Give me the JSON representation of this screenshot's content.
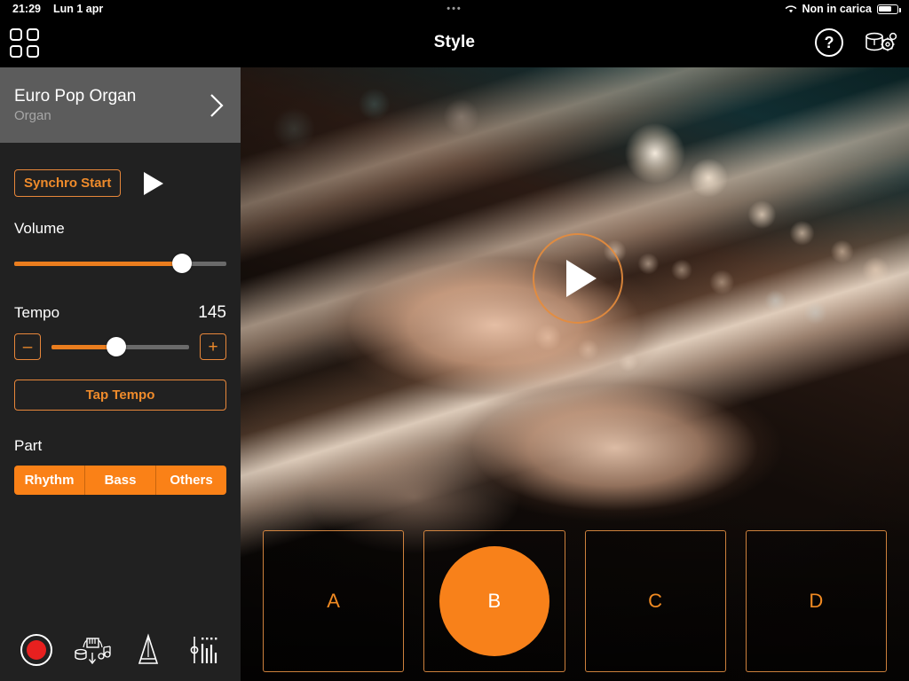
{
  "statusbar": {
    "time": "21:29",
    "date": "Lun 1 apr",
    "dots": "•••",
    "battery_text": "Non in carica",
    "wifi_icon": "wifi-icon",
    "battery_icon": "battery-icon"
  },
  "header": {
    "title": "Style",
    "grid_icon": "grid-icon",
    "help_icon": "help-icon",
    "help_label": "?",
    "database_icon": "database-settings-icon"
  },
  "sidebar": {
    "style_card": {
      "name": "Euro Pop Organ",
      "category": "Organ",
      "chevron_icon": "chevron-right-icon"
    },
    "synchro_start_label": "Synchro Start",
    "play_icon": "play-icon",
    "volume": {
      "label": "Volume",
      "value_pct": 79
    },
    "tempo": {
      "label": "Tempo",
      "value": "145",
      "value_pct": 47,
      "minus_label": "–",
      "plus_label": "+",
      "tap_tempo_label": "Tap Tempo"
    },
    "part": {
      "label": "Part",
      "segments": [
        {
          "label": "Rhythm"
        },
        {
          "label": "Bass"
        },
        {
          "label": "Others"
        }
      ]
    }
  },
  "toolbar": {
    "items": [
      {
        "icon": "record-icon"
      },
      {
        "icon": "drum-keyboard-notes-icon"
      },
      {
        "icon": "metronome-icon"
      },
      {
        "icon": "mixer-fader-icon"
      }
    ]
  },
  "stage": {
    "play_button_icon": "play-button-large",
    "variations": [
      {
        "label": "A",
        "active": false
      },
      {
        "label": "B",
        "active": true
      },
      {
        "label": "C",
        "active": false
      },
      {
        "label": "D",
        "active": false
      }
    ]
  },
  "colors": {
    "accent": "#f8811a",
    "accent_border": "#e8873a",
    "accent_text": "#ef8b2b",
    "sidebar_bg": "#212121",
    "card_bg": "#5c5c5c",
    "record_red": "#e8201f"
  }
}
